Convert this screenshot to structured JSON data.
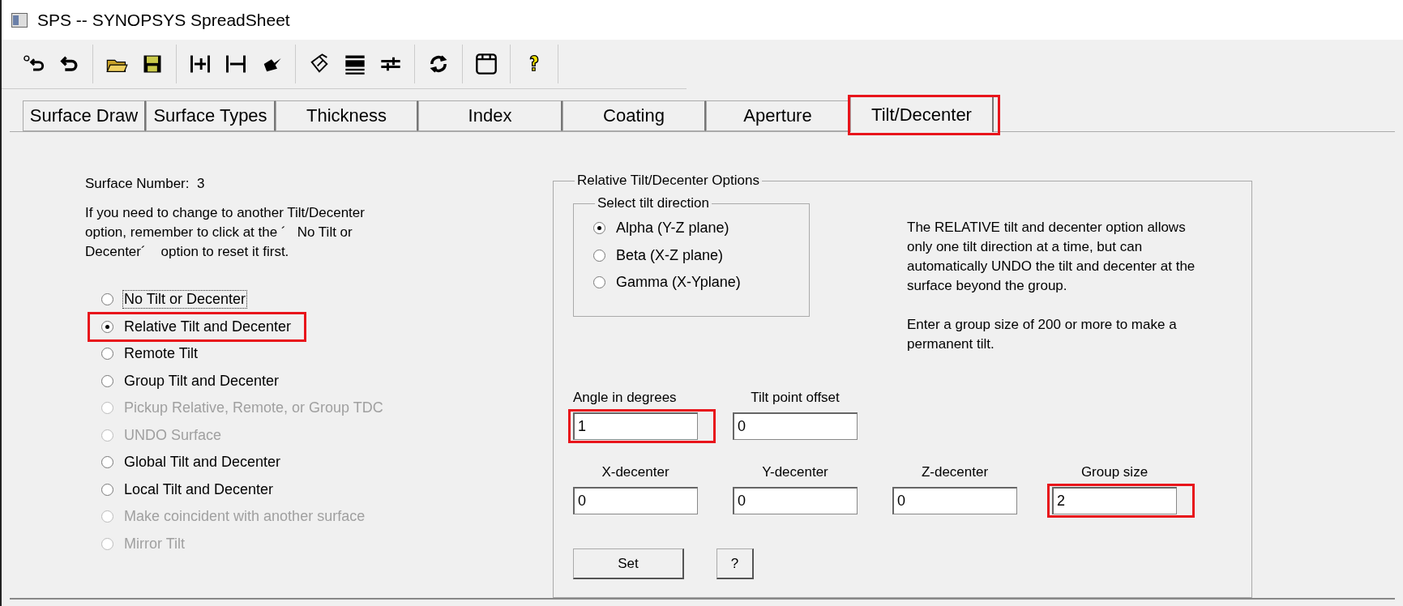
{
  "window": {
    "title": "SPS -- SYNOPSYS SpreadSheet"
  },
  "tabs": [
    {
      "label": "Surface Draw",
      "selected": false,
      "highlighted": false
    },
    {
      "label": "Surface Types",
      "selected": false,
      "highlighted": false
    },
    {
      "label": "Thickness",
      "selected": false,
      "highlighted": false
    },
    {
      "label": "Index",
      "selected": false,
      "highlighted": false
    },
    {
      "label": "Coating",
      "selected": false,
      "highlighted": false
    },
    {
      "label": "Aperture",
      "selected": false,
      "highlighted": false
    },
    {
      "label": "Tilt/Decenter",
      "selected": true,
      "highlighted": true
    }
  ],
  "surface_number": {
    "label": "Surface Number:",
    "value": "3"
  },
  "instructions": "If you need to change to another Tilt/Decenter option, remember to click at the ´   No Tilt or Decenter´    option to reset it first.",
  "tdc_options": [
    {
      "label": "No Tilt or Decenter",
      "selected": false,
      "disabled": false,
      "focused": true,
      "highlighted": false
    },
    {
      "label": "Relative Tilt and Decenter",
      "selected": true,
      "disabled": false,
      "focused": false,
      "highlighted": true
    },
    {
      "label": "Remote Tilt",
      "selected": false,
      "disabled": false,
      "focused": false,
      "highlighted": false
    },
    {
      "label": "Group Tilt and Decenter",
      "selected": false,
      "disabled": false,
      "focused": false,
      "highlighted": false
    },
    {
      "label": "Pickup Relative, Remote, or Group TDC",
      "selected": false,
      "disabled": true,
      "focused": false,
      "highlighted": false
    },
    {
      "label": "UNDO Surface",
      "selected": false,
      "disabled": true,
      "focused": false,
      "highlighted": false
    },
    {
      "label": "Global Tilt and Decenter",
      "selected": false,
      "disabled": false,
      "focused": false,
      "highlighted": false
    },
    {
      "label": "Local Tilt and Decenter",
      "selected": false,
      "disabled": false,
      "focused": false,
      "highlighted": false
    },
    {
      "label": "Make coincident with another surface",
      "selected": false,
      "disabled": true,
      "focused": false,
      "highlighted": false
    },
    {
      "label": "Mirror Tilt",
      "selected": false,
      "disabled": true,
      "focused": false,
      "highlighted": false
    }
  ],
  "relative_options": {
    "title": "Relative Tilt/Decenter Options",
    "direction": {
      "title": "Select tilt direction",
      "options": [
        {
          "label": "Alpha (Y-Z plane)",
          "selected": true
        },
        {
          "label": "Beta (X-Z plane)",
          "selected": false
        },
        {
          "label": "Gamma (X-Yplane)",
          "selected": false
        }
      ]
    },
    "description": [
      "The RELATIVE tilt and decenter option allows only one tilt direction at a time, but can automatically UNDO the tilt and decenter at the surface beyond the group.",
      "Enter a group size of 200 or more to make a permanent tilt."
    ],
    "fields_row_1": [
      {
        "label": "Angle in degrees",
        "value": "1",
        "highlighted": true
      },
      {
        "label": "Tilt point offset",
        "value": "0",
        "highlighted": false
      }
    ],
    "fields_row_2": [
      {
        "label": "X-decenter",
        "value": "0",
        "highlighted": false
      },
      {
        "label": "Y-decenter",
        "value": "0",
        "highlighted": false
      },
      {
        "label": "Z-decenter",
        "value": "0",
        "highlighted": false
      },
      {
        "label": "Group size",
        "value": "2",
        "highlighted": true
      }
    ],
    "set_button": "Set",
    "help_button": "?"
  }
}
